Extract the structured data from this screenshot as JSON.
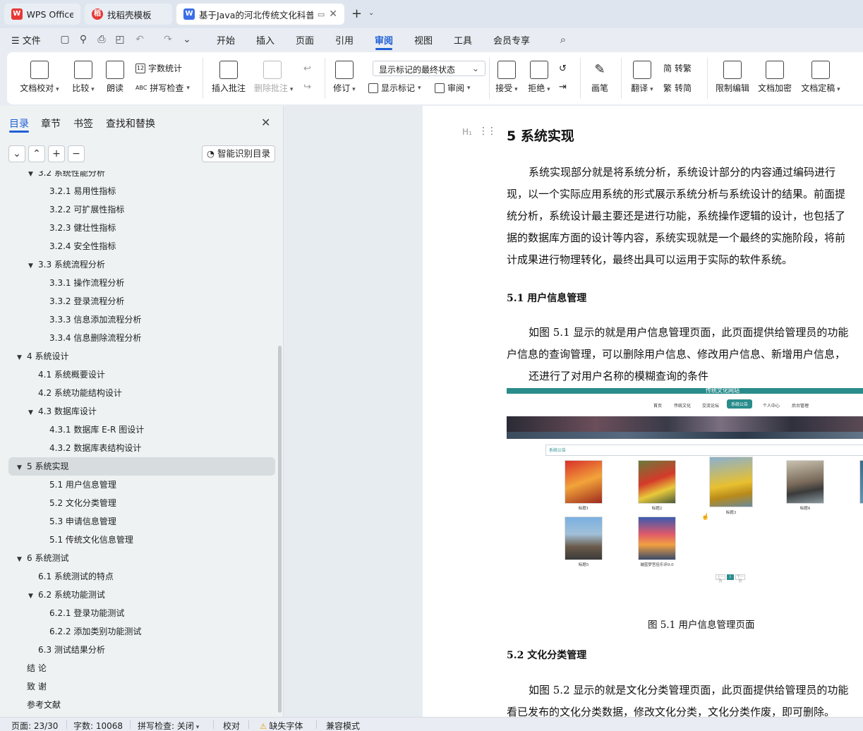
{
  "tabs": [
    {
      "label": "WPS Office",
      "icon": "wps-logo-icon"
    },
    {
      "label": "找稻壳模板",
      "icon": "docer-icon"
    },
    {
      "label": "基于Java的河北传统文化科普网",
      "icon": "word-doc-icon"
    }
  ],
  "menu": {
    "file": "文件",
    "items": [
      "开始",
      "插入",
      "页面",
      "引用",
      "审阅",
      "视图",
      "工具",
      "会员专享"
    ],
    "active": "审阅"
  },
  "ribbon": {
    "doc_check": "文档校对",
    "compare": "比较",
    "read_aloud": "朗读",
    "word_count": "字数统计",
    "spell_check": "拼写检查",
    "insert_comment": "插入批注",
    "delete_comment": "删除批注",
    "revise": "修订",
    "markup_state": "显示标记的最终状态",
    "show_markup": "显示标记",
    "review_pane": "审阅",
    "accept": "接受",
    "reject": "拒绝",
    "pen": "画笔",
    "translate": "翻译",
    "to_traditional": "转繁",
    "to_simplified": "转简",
    "restrict_edit": "限制编辑",
    "encrypt": "文档加密",
    "finalize": "文档定稿"
  },
  "panel": {
    "tabs": [
      "目录",
      "章节",
      "书签",
      "查找和替换"
    ],
    "smart_toc": "智能识别目录",
    "toc": [
      {
        "label": "3.2  系统性能分析",
        "level": 2,
        "expand": "▼"
      },
      {
        "label": "3.2.1  易用性指标",
        "level": 3
      },
      {
        "label": "3.2.2  可扩展性指标",
        "level": 3
      },
      {
        "label": "3.2.3  健壮性指标",
        "level": 3
      },
      {
        "label": "3.2.4  安全性指标",
        "level": 3
      },
      {
        "label": "3.3  系统流程分析",
        "level": 2,
        "expand": "▼"
      },
      {
        "label": "3.3.1  操作流程分析",
        "level": 3
      },
      {
        "label": "3.3.2  登录流程分析",
        "level": 3
      },
      {
        "label": "3.3.3  信息添加流程分析",
        "level": 3
      },
      {
        "label": "3.3.4  信息删除流程分析",
        "level": 3
      },
      {
        "label": "4  系统设计",
        "level": 1,
        "expand": "▼"
      },
      {
        "label": "4.1  系统概要设计",
        "level": 2
      },
      {
        "label": "4.2  系统功能结构设计",
        "level": 2
      },
      {
        "label": "4.3  数据库设计",
        "level": 2,
        "expand": "▼"
      },
      {
        "label": "4.3.1  数据库 E-R 图设计",
        "level": 3
      },
      {
        "label": "4.3.2  数据库表结构设计",
        "level": 3
      },
      {
        "label": "5  系统实现",
        "level": 1,
        "expand": "▼",
        "selected": true
      },
      {
        "label": "5.1 用户信息管理",
        "level": 3
      },
      {
        "label": "5.2  文化分类管理",
        "level": 3
      },
      {
        "label": "5.3 申请信息管理",
        "level": 3
      },
      {
        "label": "5.1 传统文化信息管理",
        "level": 3
      },
      {
        "label": "6  系统测试",
        "level": 1,
        "expand": "▼"
      },
      {
        "label": "6.1  系统测试的特点",
        "level": 2
      },
      {
        "label": "6.2  系统功能测试",
        "level": 2,
        "expand": "▼"
      },
      {
        "label": "6.2.1  登录功能测试",
        "level": 3
      },
      {
        "label": "6.2.2  添加类别功能测试",
        "level": 3
      },
      {
        "label": "6.3  测试结果分析",
        "level": 2
      },
      {
        "label": "结    论",
        "level": 1
      },
      {
        "label": "致    谢",
        "level": 1
      },
      {
        "label": "参考文献",
        "level": 1
      }
    ]
  },
  "doc": {
    "heading": "5  系统实现",
    "p1": [
      "系统实现部分就是将系统分析，系统设计部分的内容通过编码进行",
      "现，以一个实际应用系统的形式展示系统分析与系统设计的结果。前面提",
      "统分析，系统设计最主要还是进行功能，系统操作逻辑的设计，也包括了",
      "据的数据库方面的设计等内容，系统实现就是一个最终的实施阶段，将前",
      "计成果进行物理转化，最终出具可以运用于实际的软件系统。"
    ],
    "h51": "5.1 用户信息管理",
    "p2": [
      "如图 5.1 显示的就是用户信息管理页面，此页面提供给管理员的功能",
      "户信息的查询管理，可以删除用户信息、修改用户信息、新增用户信息，",
      "还进行了对用户名称的模糊查询的条件"
    ],
    "figure": {
      "site_title": "传统文化网站",
      "nav": [
        "首页",
        "传统文化",
        "交流论坛",
        "系统公告",
        "个人中心",
        "后台管理"
      ],
      "nav_active": "系统公告",
      "section": "系统公告",
      "items": [
        "标题1",
        "标题2",
        "标题3",
        "标题4",
        "标题5",
        "端蓝梦宫佳乐评9.0"
      ],
      "pager": [
        "上一页",
        "1",
        "下一页"
      ]
    },
    "caption": "图 5.1  用户信息管理页面",
    "h52": "5.2  文化分类管理",
    "p3": [
      "如图 5.2 显示的就是文化分类管理页面，此页面提供给管理员的功能",
      "看已发布的文化分类数据，修改文化分类，文化分类作废，即可删除。"
    ]
  },
  "status": {
    "page": "页面: 23/30",
    "words": "字数: 10068",
    "spell": "拼写检查: 关闭",
    "proof": "校对",
    "missing_font": "缺失字体",
    "compat": "兼容模式"
  }
}
